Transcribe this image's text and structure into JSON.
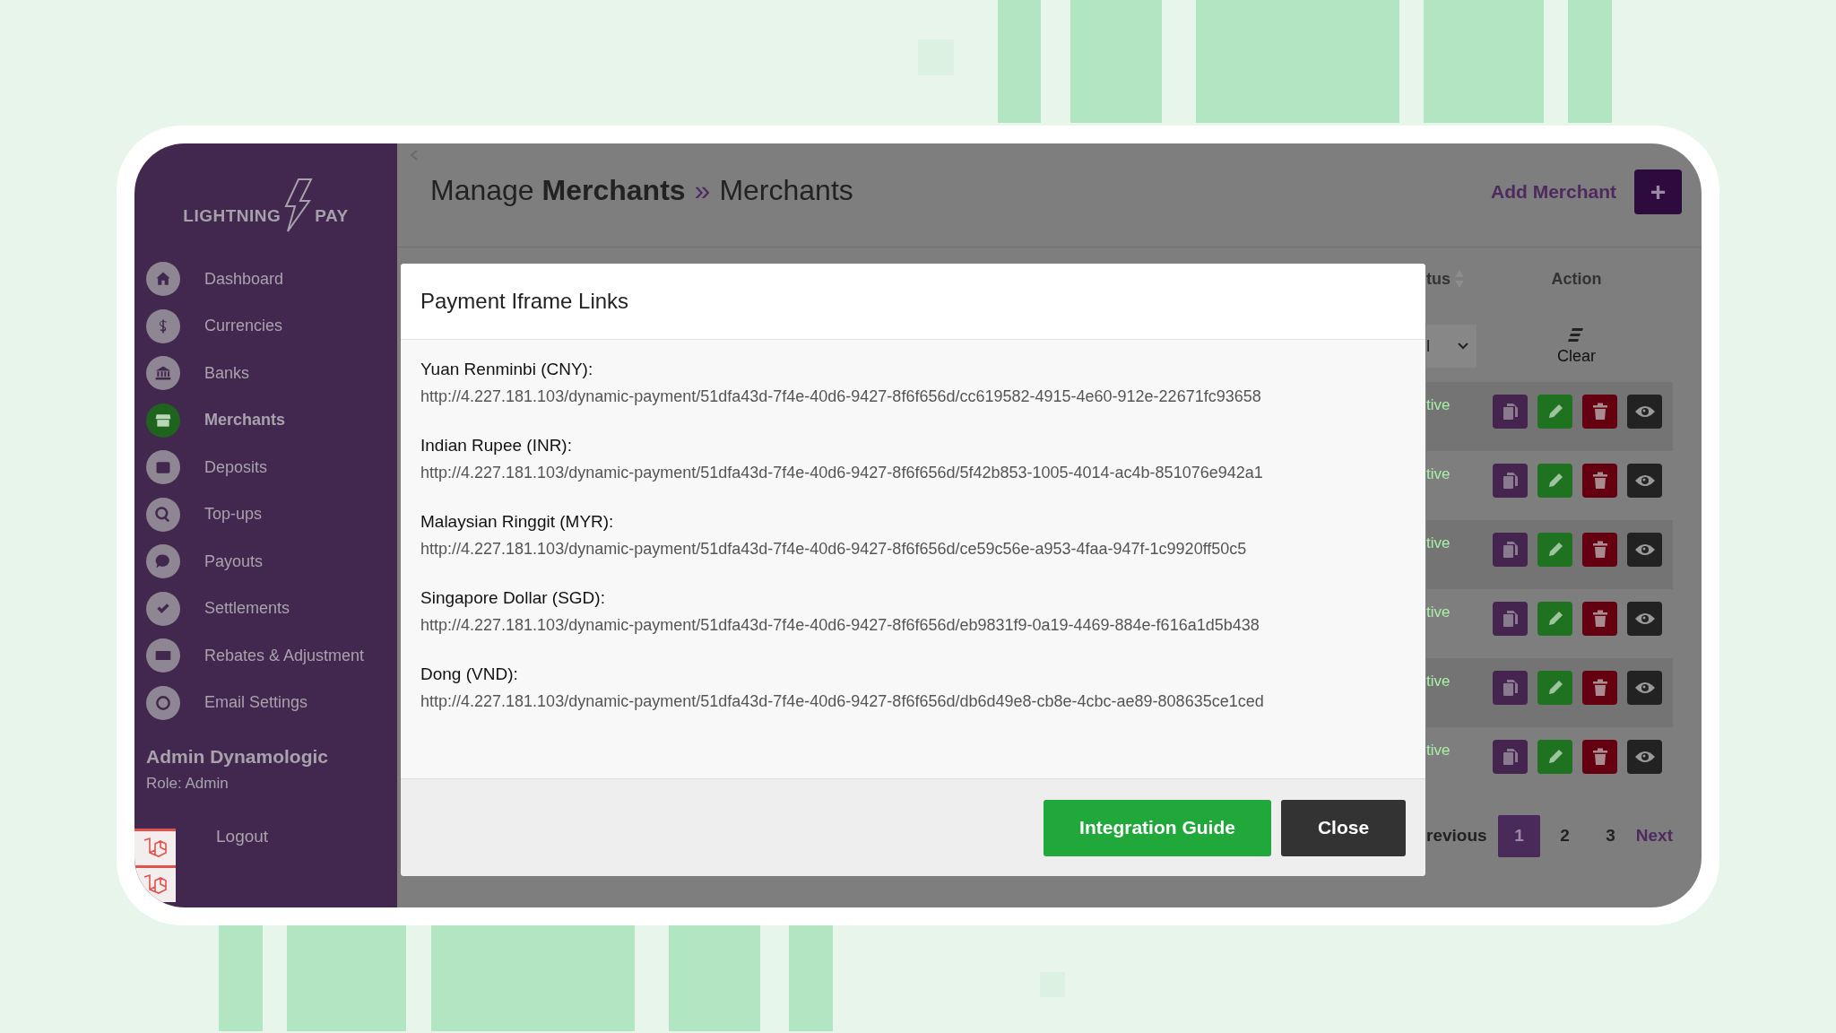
{
  "sidebar": {
    "logo": {
      "left": "LIGHTNING",
      "right": "PAY"
    },
    "items": [
      {
        "label": "Dashboard",
        "selected": false
      },
      {
        "label": "Currencies",
        "selected": false
      },
      {
        "label": "Banks",
        "selected": false
      },
      {
        "label": "Merchants",
        "selected": true
      },
      {
        "label": "Deposits",
        "selected": false
      },
      {
        "label": "Top-ups",
        "selected": false
      },
      {
        "label": "Payouts",
        "selected": false
      },
      {
        "label": "Settlements",
        "selected": false
      },
      {
        "label": "Rebates & Adjustment",
        "selected": false
      },
      {
        "label": "Email Settings",
        "selected": false
      }
    ],
    "user": {
      "name": "Admin Dynamologic",
      "role": "Role: Admin"
    },
    "logout": "Logout"
  },
  "header": {
    "title": "Manage **Merchants**",
    "separator": "»",
    "subtitle": "Merchants",
    "add_label": "Add Merchant",
    "add_button": "+"
  },
  "table": {
    "columns": [
      {
        "label": "tus",
        "sortable": true
      },
      {
        "label": "Action",
        "sortable": false
      }
    ],
    "filter_value": "l",
    "clear_label": "Clear",
    "rows": [
      {
        "status": "tive"
      },
      {
        "status": "tive"
      },
      {
        "status": "tive"
      },
      {
        "status": "tive"
      },
      {
        "status": "tive"
      },
      {
        "status": "tive"
      }
    ]
  },
  "pagination": {
    "previous": "revious",
    "pages": [
      {
        "label": "1",
        "selected": true
      },
      {
        "label": "2",
        "selected": false
      },
      {
        "label": "3",
        "selected": false
      }
    ],
    "next": "Next"
  },
  "modal": {
    "title": "Payment Iframe Links",
    "links": [
      {
        "label": "Yuan Renminbi (CNY):",
        "url": "http://4.227.181.103/dynamic-payment/51dfa43d-7f4e-40d6-9427-8f6f656d/cc619582-4915-4e60-912e-22671fc93658"
      },
      {
        "label": "Indian Rupee (INR):",
        "url": "http://4.227.181.103/dynamic-payment/51dfa43d-7f4e-40d6-9427-8f6f656d/5f42b853-1005-4014-ac4b-851076e942a1"
      },
      {
        "label": "Malaysian Ringgit (MYR):",
        "url": "http://4.227.181.103/dynamic-payment/51dfa43d-7f4e-40d6-9427-8f6f656d/ce59c56e-a953-4faa-947f-1c9920ff50c5"
      },
      {
        "label": "Singapore Dollar (SGD):",
        "url": "http://4.227.181.103/dynamic-payment/51dfa43d-7f4e-40d6-9427-8f6f656d/eb9831f9-0a19-4469-884e-f616a1d5b438"
      },
      {
        "label": "Dong (VND):",
        "url": "http://4.227.181.103/dynamic-payment/51dfa43d-7f4e-40d6-9427-8f6f656d/db6d49e8-cb8e-4cbc-ae89-808635ce1ced"
      }
    ],
    "buttons": [
      {
        "label": "Integration Guide",
        "kind": "primary"
      },
      {
        "label": "Close",
        "kind": "secondary"
      }
    ]
  }
}
